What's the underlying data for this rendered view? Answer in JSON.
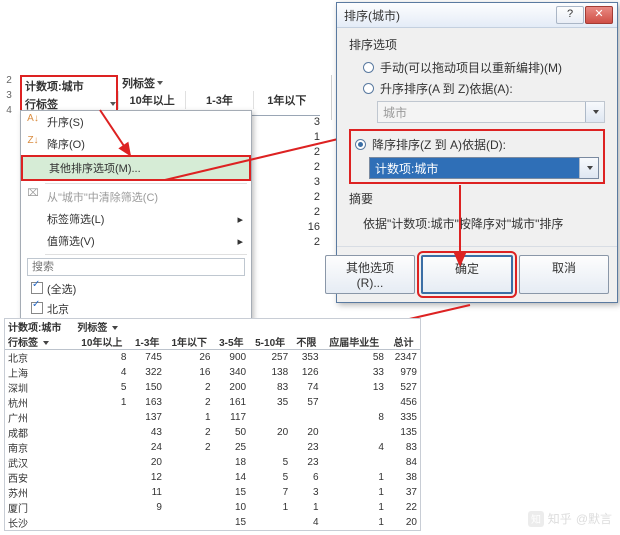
{
  "pivot_head": {
    "title1": "计数项:城市",
    "title2": "行标签",
    "col_label": "列标签",
    "col1": "10年以上",
    "col2": "1-3年",
    "col3": "1年以下",
    "row_ids": [
      "2",
      "3",
      "4"
    ]
  },
  "context_menu": {
    "asc": "升序(S)",
    "desc": "降序(O)",
    "more_sort": "其他排序选项(M)...",
    "clear_filter": "从\"城市\"中清除筛选(C)",
    "label_filter": "标签筛选(L)",
    "value_filter": "值筛选(V)",
    "search_placeholder": "搜索",
    "check_all": "(全选)",
    "check_item2": "北京"
  },
  "mini_values": [
    "3",
    "1",
    "2",
    "2",
    "3",
    "2",
    "2",
    "",
    "",
    "16",
    "2"
  ],
  "dialog": {
    "title": "排序(城市)",
    "help_tip": "?",
    "section": "排序选项",
    "r_manual": "手动(可以拖动项目以重新编排)(M)",
    "r_asc": "升序排序(A 到 Z)依据(A):",
    "r_desc": "降序排序(Z 到 A)依据(D):",
    "combo_disabled": "城市",
    "combo_selected": "计数项:城市",
    "summary_label": "摘要",
    "summary_text": "依据\"计数项:城市\"按降序对\"城市\"排序",
    "btn_more": "其他选项(R)...",
    "btn_ok": "确定",
    "btn_cancel": "取消"
  },
  "chart_data": {
    "type": "table",
    "title1": "计数项:城市",
    "title2": "列标签",
    "row_label": "行标签",
    "columns": [
      "10年以上",
      "1-3年",
      "1年以下",
      "3-5年",
      "5-10年",
      "不限",
      "应届毕业生",
      "总计"
    ],
    "rows": [
      {
        "label": "北京",
        "v": [
          8,
          745,
          26,
          900,
          257,
          353,
          58,
          2347
        ]
      },
      {
        "label": "上海",
        "v": [
          4,
          322,
          16,
          340,
          138,
          126,
          33,
          979
        ]
      },
      {
        "label": "深圳",
        "v": [
          5,
          150,
          2,
          200,
          83,
          74,
          13,
          527
        ]
      },
      {
        "label": "杭州",
        "v": [
          1,
          163,
          2,
          161,
          35,
          57,
          null,
          456
        ]
      },
      {
        "label": "广州",
        "v": [
          null,
          137,
          1,
          117,
          null,
          null,
          8,
          335
        ]
      },
      {
        "label": "成都",
        "v": [
          null,
          43,
          2,
          50,
          20,
          20,
          null,
          135
        ]
      },
      {
        "label": "南京",
        "v": [
          null,
          24,
          2,
          25,
          null,
          23,
          4,
          83
        ]
      },
      {
        "label": "武汉",
        "v": [
          null,
          20,
          null,
          18,
          5,
          23,
          null,
          84
        ]
      },
      {
        "label": "西安",
        "v": [
          null,
          12,
          null,
          14,
          5,
          6,
          1,
          38
        ]
      },
      {
        "label": "苏州",
        "v": [
          null,
          11,
          null,
          15,
          7,
          3,
          1,
          37
        ]
      },
      {
        "label": "厦门",
        "v": [
          null,
          9,
          null,
          10,
          1,
          1,
          1,
          22
        ]
      },
      {
        "label": "长沙",
        "v": [
          null,
          null,
          null,
          15,
          null,
          4,
          1,
          20
        ]
      }
    ]
  },
  "watermark": {
    "brand": "知乎",
    "at": "@默言"
  }
}
